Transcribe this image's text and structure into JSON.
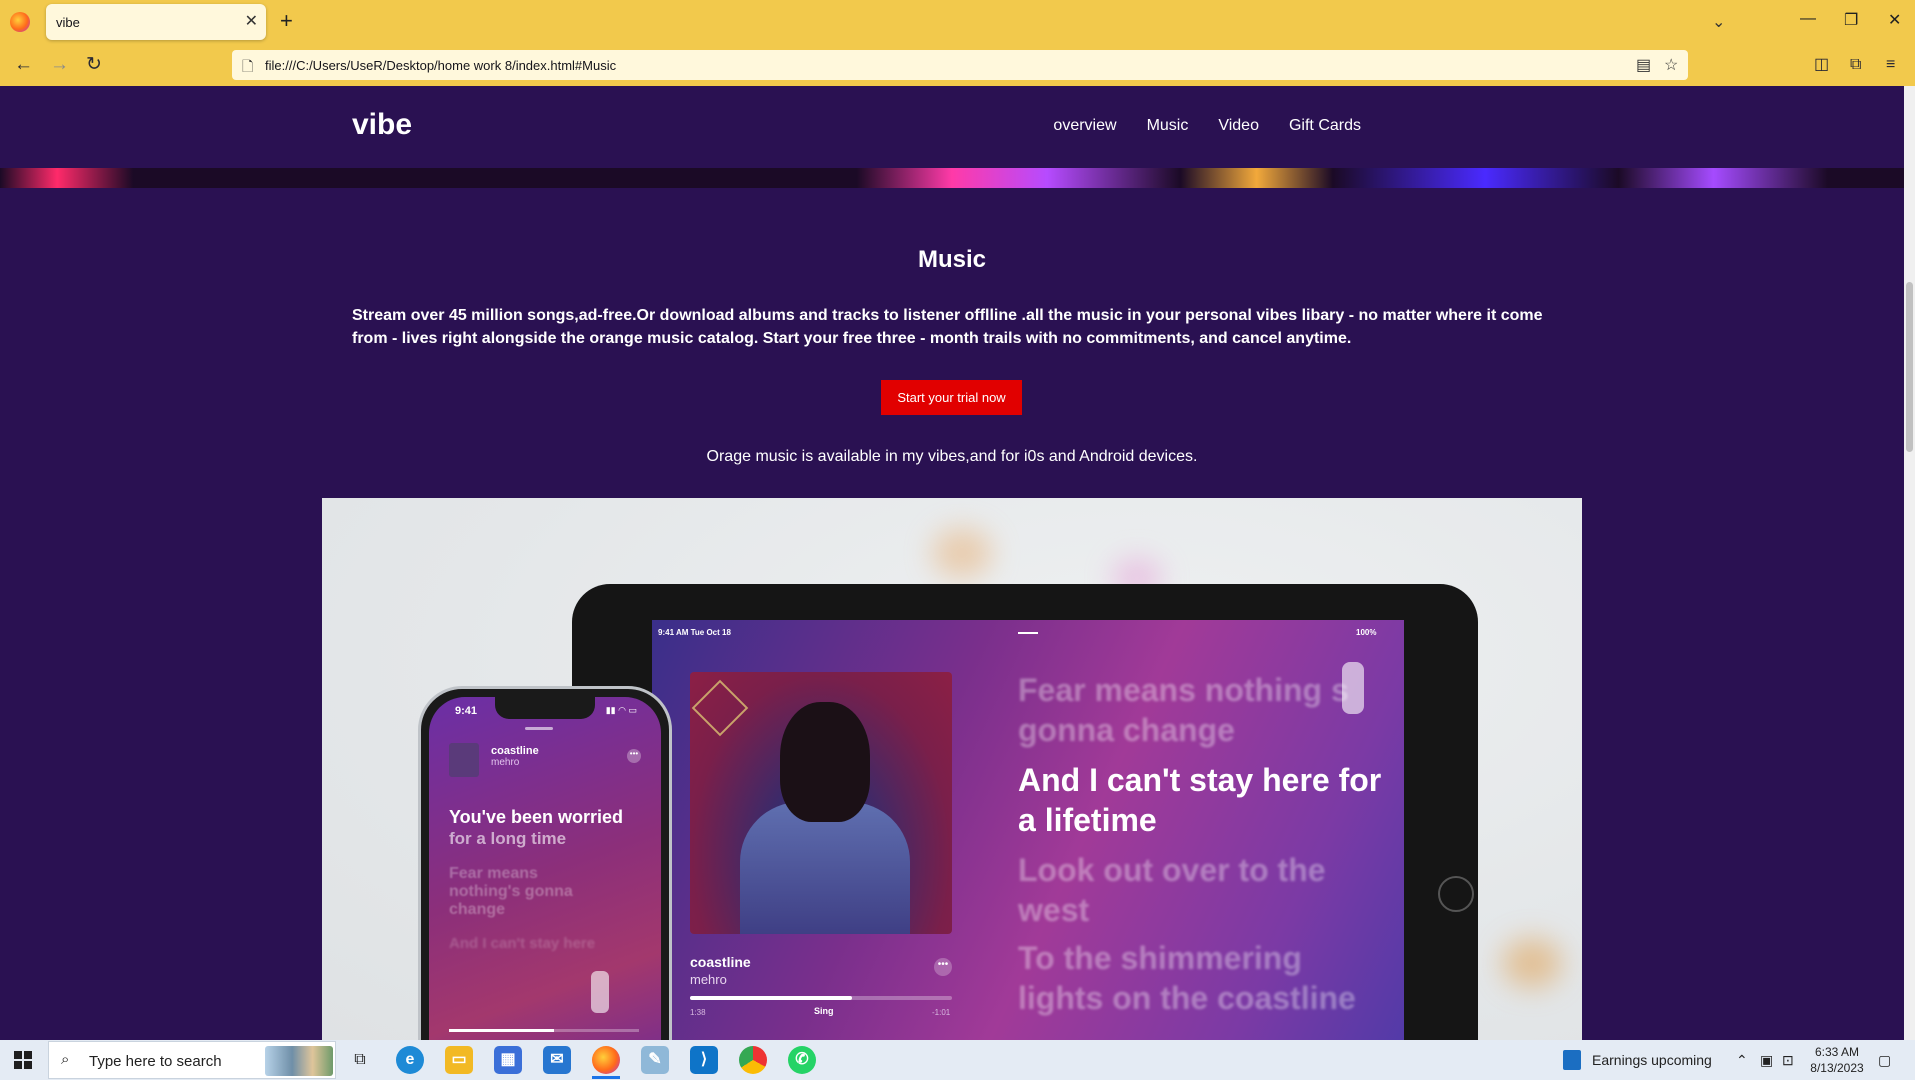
{
  "browser": {
    "tab_title": "vibe",
    "url": "file:///C:/Users/UseR/Desktop/home%20work%208/index.html#Music",
    "url_display": "file:///C:/Users/UseR/Desktop/home work 8/index.html#Music"
  },
  "site": {
    "brand": "vibe",
    "nav": [
      "overview",
      "Music",
      "Video",
      "Gift Cards"
    ]
  },
  "section": {
    "title": "Music",
    "description": "Stream over 45 million songs,ad-free.Or download albums and tracks to listener offlline .all the music in your personal vibes libary - no matter where it come from - lives right alongside the orange music catalog. Start your free three - month trails with no commitments, and cancel anytime.",
    "cta_label": "Start your trial now",
    "availability": "Orage music is available in my vibes,and for i0s and Android devices."
  },
  "hero_image": {
    "tablet": {
      "status_time": "9:41 AM  Tue Oct 18",
      "status_battery": "100%",
      "song": "coastline",
      "artist": "mehro",
      "sing_label": "Sing",
      "time_elapsed": "1:38",
      "time_remaining": "-1:01",
      "progress": 0.62,
      "lyrics": [
        "Fear means nothing s gonna change",
        "And I can't stay here for a lifetime",
        "Look out over to the west",
        "To the shimmering lights on the coastline"
      ]
    },
    "phone": {
      "status_time": "9:41",
      "song": "coastline",
      "artist": "mehro",
      "progress": 0.55,
      "lyrics": [
        "You've been worried",
        "for a long time",
        "Fear means nothing's gonna change",
        "And I can't stay here"
      ]
    }
  },
  "taskbar": {
    "search_placeholder": "Type here to search",
    "news": "Earnings upcoming",
    "time": "6:33 AM",
    "date": "8/13/2023"
  },
  "colors": {
    "page_bg": "#2a1152",
    "cta_bg": "#e10000",
    "browser_chrome": "#f2c94c"
  },
  "icons": [
    "firefox-icon",
    "close-icon",
    "plus-icon",
    "back-icon",
    "forward-icon",
    "reload-icon",
    "page-icon",
    "reader-view-icon",
    "bookmark-star-icon",
    "pocket-icon",
    "extensions-icon",
    "menu-icon",
    "windows-start-icon",
    "search-icon",
    "task-view-icon",
    "edge-icon",
    "file-explorer-icon",
    "store-icon",
    "mail-icon",
    "vscode-icon",
    "chrome-icon",
    "whatsapp-icon"
  ]
}
